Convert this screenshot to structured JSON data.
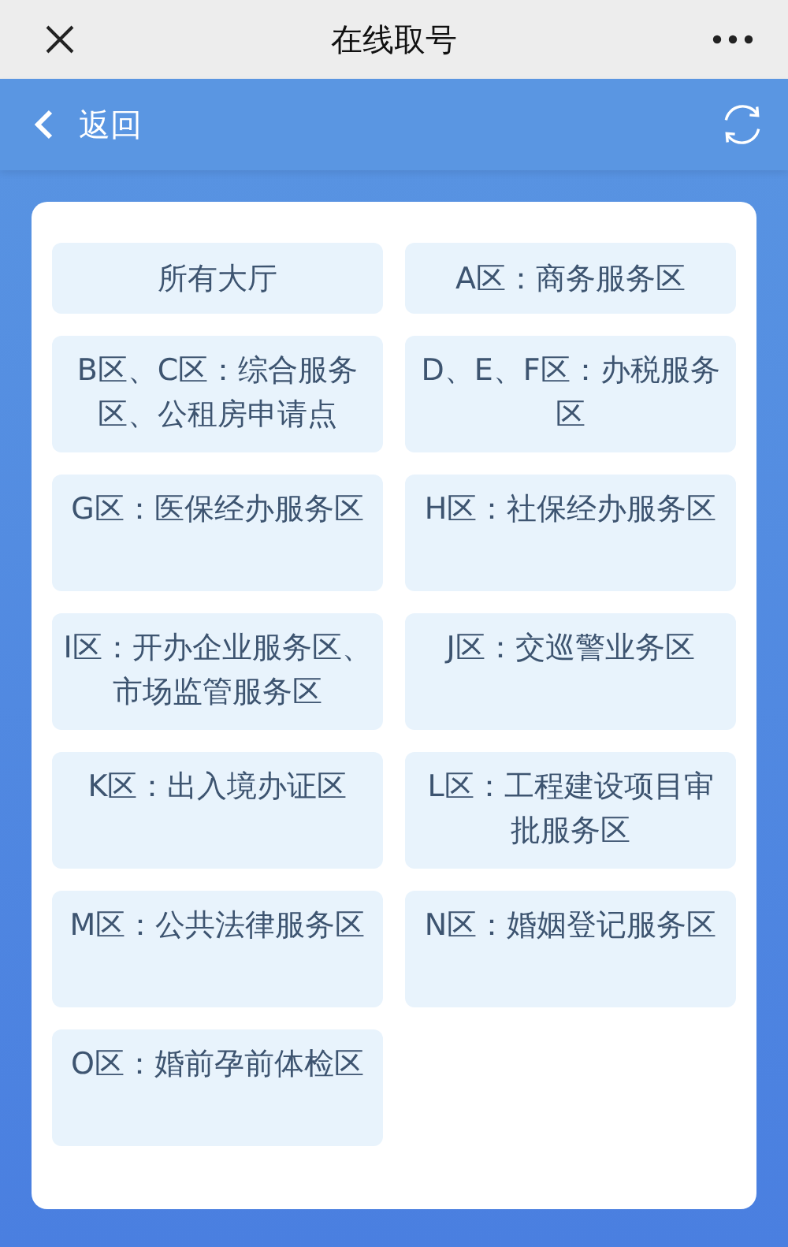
{
  "top_bar": {
    "title": "在线取号"
  },
  "nav_bar": {
    "back_label": "返回"
  },
  "halls": [
    {
      "label": "所有大厅"
    },
    {
      "label": "A区：商务服务区"
    },
    {
      "label": "B区、C区：综合服务区、公租房申请点"
    },
    {
      "label": "D、E、F区：办税服务区"
    },
    {
      "label": "G区：医保经办服务区"
    },
    {
      "label": "H区：社保经办服务区"
    },
    {
      "label": "I区：开办企业服务区、市场监管服务区"
    },
    {
      "label": "J区：交巡警业务区"
    },
    {
      "label": "K区：出入境办证区"
    },
    {
      "label": "L区：工程建设项目审批服务区"
    },
    {
      "label": "M区：公共法律服务区"
    },
    {
      "label": "N区：婚姻登记服务区"
    },
    {
      "label": "O区：婚前孕前体检区"
    }
  ]
}
